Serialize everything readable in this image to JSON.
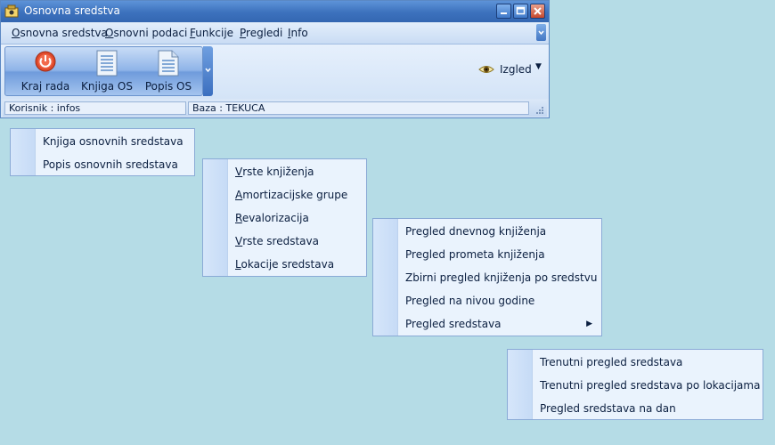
{
  "window": {
    "title": "Osnovna sredstva",
    "colors": {
      "titlebar": "#3c71bd",
      "desktop": "#b5dce6",
      "menu_bg": "#eaf3fd"
    }
  },
  "menubar": {
    "items": [
      {
        "first": "O",
        "rest": "snovna sredstva"
      },
      {
        "first": "O",
        "rest": "snovni podaci"
      },
      {
        "first": "F",
        "rest": "unkcije"
      },
      {
        "first": "P",
        "rest": "regledi"
      },
      {
        "first": "I",
        "rest": "nfo"
      }
    ]
  },
  "toolbar": {
    "buttons": [
      {
        "label": "Kraj rada",
        "icon": "power-icon"
      },
      {
        "label": "Knjiga OS",
        "icon": "document-icon"
      },
      {
        "label": "Popis OS",
        "icon": "document-icon"
      }
    ],
    "view_label": "Izgled",
    "view_icon": "eye-icon"
  },
  "statusbar": {
    "user": "Korisnik : infos",
    "database": "Baza : TEKUCA"
  },
  "menus": {
    "osnovna_sredstva": [
      "Knjiga osnovnih sredstava",
      "Popis osnovnih sredstava"
    ],
    "osnovni_podaci": [
      {
        "first": "V",
        "rest": "rste knjiženja"
      },
      {
        "first": "A",
        "rest": "mortizacijske grupe"
      },
      {
        "first": "R",
        "rest": "evalorizacija"
      },
      {
        "first": "V",
        "rest": "rste sredstava"
      },
      {
        "first": "L",
        "rest": "okacije sredstava"
      }
    ],
    "pregledi": [
      "Pregled dnevnog knjiženja",
      "Pregled prometa knjiženja",
      "Zbirni pregled knjiženja po sredstvu",
      "Pregled na nivou godine",
      "Pregled sredstava"
    ],
    "pregled_sredstava": [
      "Trenutni pregled sredstava",
      "Trenutni pregled sredstava po lokacijama",
      "Pregled sredstava na dan"
    ]
  }
}
